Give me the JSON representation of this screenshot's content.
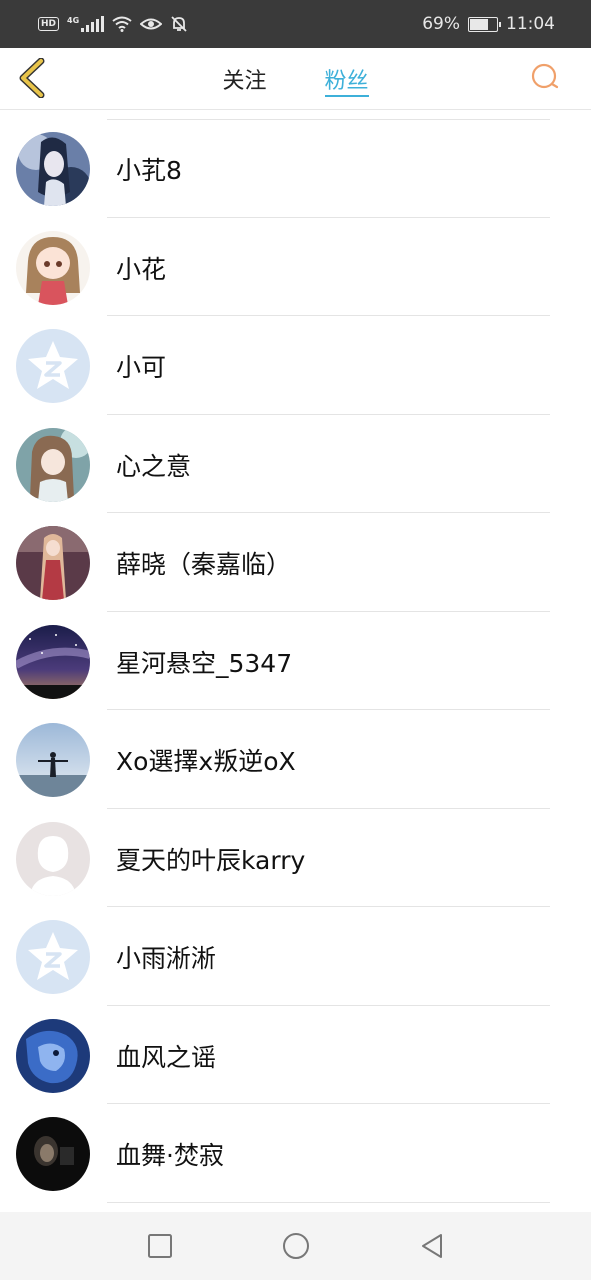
{
  "status_bar": {
    "hd": "HD",
    "network": "4G",
    "battery_percent": "69%",
    "battery_level": 0.69,
    "time": "11:04"
  },
  "header": {
    "tabs": [
      {
        "label": "关注",
        "active": false
      },
      {
        "label": "粉丝",
        "active": true
      }
    ],
    "accent_color": "#3db0d9",
    "back_icon_color": "#e8b93a",
    "search_icon_color": "#f0a06a"
  },
  "followers": [
    {
      "name": "小芤8",
      "avatar": "anime-girl-blue-avatar"
    },
    {
      "name": "小花",
      "avatar": "chibi-girl-avatar"
    },
    {
      "name": "小可",
      "avatar": "default-qq-avatar"
    },
    {
      "name": "心之意",
      "avatar": "anime-girl-teal-avatar"
    },
    {
      "name": "薛晓（秦嘉临）",
      "avatar": "anime-girl-red-avatar"
    },
    {
      "name": "星河悬空_5347",
      "avatar": "galaxy-night-avatar"
    },
    {
      "name": "Xo選擇x叛逆oX",
      "avatar": "person-sunset-avatar"
    },
    {
      "name": "夏天的叶辰karry",
      "avatar": "default-silhouette-avatar"
    },
    {
      "name": "小雨淅淅",
      "avatar": "default-qq-avatar"
    },
    {
      "name": "血风之谣",
      "avatar": "blue-dragon-avatar"
    },
    {
      "name": "血舞·焚寂",
      "avatar": "dark-portrait-avatar"
    }
  ],
  "bottom_nav": {
    "icons": [
      "recent-apps-icon",
      "home-icon",
      "back-triangle-icon"
    ]
  }
}
